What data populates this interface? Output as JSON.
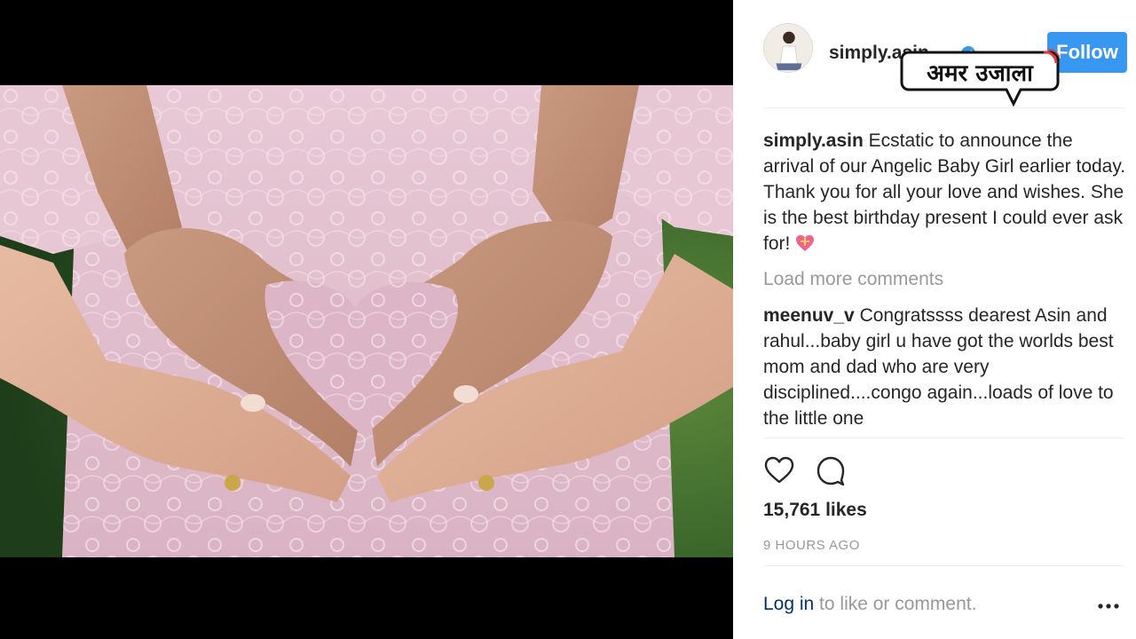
{
  "post": {
    "username": "simply.asin",
    "follow_label": "Follow",
    "caption_text": "Ecstatic to announce the arrival of our Angelic Baby Girl earlier today. Thank you for all your love and wishes. She is the best birthday present I could ever ask for!",
    "load_more": "Load more comments",
    "likes": "15,761 likes",
    "time": "9 HOURS AGO",
    "login_link": "Log in",
    "login_rest": " to like or comment."
  },
  "comments": [
    {
      "username": "meenuv_v",
      "text": "Congratssss dearest Asin and rahul...baby girl u have got the worlds best mom and dad who are very disciplined....congo again...loads of love to the little one"
    }
  ],
  "watermark": {
    "text": "अमर उजाला"
  },
  "icons": {
    "like": "heart-icon",
    "comment": "comment-icon",
    "more": "more-options-icon",
    "verified": "verified-badge-icon"
  },
  "colors": {
    "accent": "#3897f0",
    "link": "#003569",
    "muted": "#999999",
    "text": "#262626"
  }
}
